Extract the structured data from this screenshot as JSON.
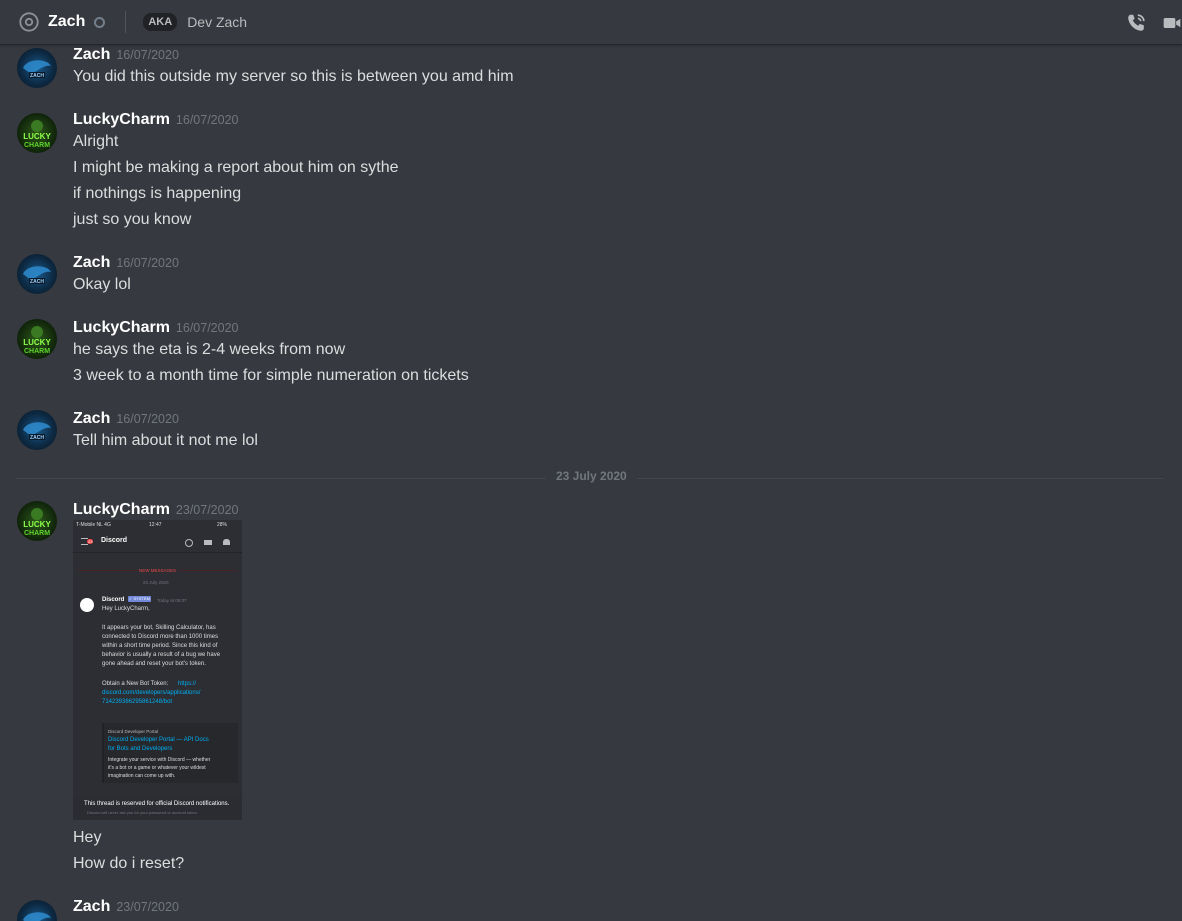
{
  "header": {
    "title": "Zach",
    "aka_label": "AKA",
    "nickname": "Dev Zach"
  },
  "icons": {
    "at": "at-icon",
    "status": "status-offline-icon",
    "call": "phone-call-icon",
    "video": "video-camera-icon"
  },
  "messages": [
    {
      "author": "Zach",
      "timestamp": "16/07/2020",
      "lines": [
        "You did this outside my server so this is between you amd him"
      ]
    },
    {
      "author": "LuckyCharm",
      "timestamp": "16/07/2020",
      "lines": [
        "Alright",
        "I might be making a report about him on sythe",
        "if nothings is happening",
        "just so you know"
      ]
    },
    {
      "author": "Zach",
      "timestamp": "16/07/2020",
      "lines": [
        "Okay lol"
      ]
    },
    {
      "author": "LuckyCharm",
      "timestamp": "16/07/2020",
      "lines": [
        "he says the eta is 2-4 weeks from now",
        "3 week to a month time for simple numeration on tickets"
      ]
    },
    {
      "author": "Zach",
      "timestamp": "16/07/2020",
      "lines": [
        "Tell him about it not me lol"
      ]
    },
    {
      "author": "LuckyCharm",
      "timestamp": "23/07/2020",
      "lines": [
        "Hey",
        "How do i reset?"
      ]
    },
    {
      "author": "Zach",
      "timestamp": "23/07/2020",
      "lines": []
    }
  ],
  "date_divider": "23 July 2020",
  "attachment": {
    "carrier": "T-Mobile NL  4G",
    "time": "12:47",
    "battery": "28%",
    "badge": "23",
    "channel": "Discord",
    "new_messages": "NEW MESSAGES",
    "date": "23 July 2020",
    "author": "Discord",
    "system_tag": "✓ SYSTEM",
    "sent": "Today at 05:07",
    "greeting": "Hey LuckyCharm,",
    "body": [
      "It appears your bot, Skilling Calculator, has",
      "connected to Discord more than 1000 times",
      "within a short time period. Since this kind of",
      "behavior is usually a result of a bug we have",
      "gone ahead and reset your bot's token."
    ],
    "token_label": "Obtain a New Bot Token:",
    "token_link": [
      "https://",
      "discord.com/developers/applications/",
      "714239386295861248/bot"
    ],
    "embed_provider": "Discord Developer Portal",
    "embed_title": [
      "Discord Developer Portal — API Docs",
      "for Bots and Developers"
    ],
    "embed_desc": [
      "Integrate your service with Discord — whether",
      "it's a bot or a game or whatever your wildest",
      "imagination can come up with."
    ],
    "footer_title": "This thread is reserved for official Discord notifications.",
    "footer_sub": "Discord will never ask you for your password or account token."
  }
}
